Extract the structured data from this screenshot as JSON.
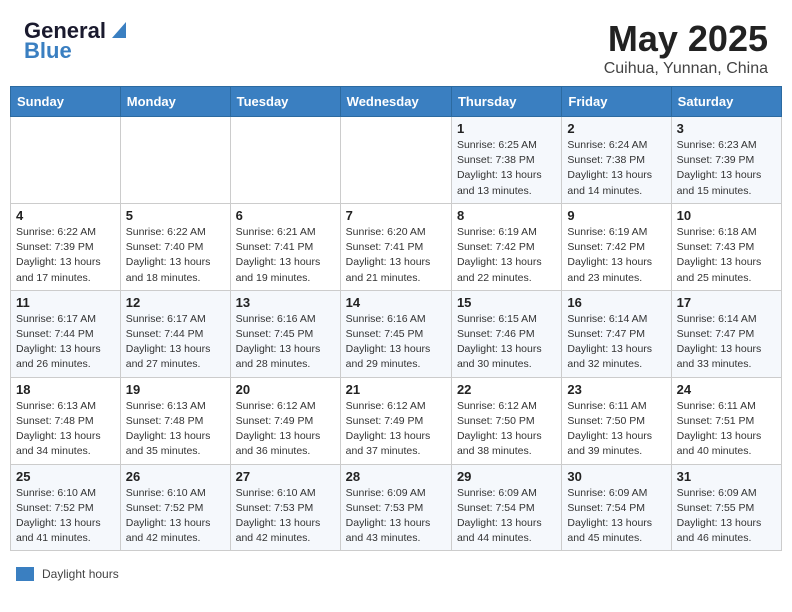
{
  "header": {
    "logo_line1": "General",
    "logo_line2": "Blue",
    "main_title": "May 2025",
    "subtitle": "Cuihua, Yunnan, China"
  },
  "weekdays": [
    "Sunday",
    "Monday",
    "Tuesday",
    "Wednesday",
    "Thursday",
    "Friday",
    "Saturday"
  ],
  "weeks": [
    [
      {
        "day": "",
        "info": ""
      },
      {
        "day": "",
        "info": ""
      },
      {
        "day": "",
        "info": ""
      },
      {
        "day": "",
        "info": ""
      },
      {
        "day": "1",
        "info": "Sunrise: 6:25 AM\nSunset: 7:38 PM\nDaylight: 13 hours\nand 13 minutes."
      },
      {
        "day": "2",
        "info": "Sunrise: 6:24 AM\nSunset: 7:38 PM\nDaylight: 13 hours\nand 14 minutes."
      },
      {
        "day": "3",
        "info": "Sunrise: 6:23 AM\nSunset: 7:39 PM\nDaylight: 13 hours\nand 15 minutes."
      }
    ],
    [
      {
        "day": "4",
        "info": "Sunrise: 6:22 AM\nSunset: 7:39 PM\nDaylight: 13 hours\nand 17 minutes."
      },
      {
        "day": "5",
        "info": "Sunrise: 6:22 AM\nSunset: 7:40 PM\nDaylight: 13 hours\nand 18 minutes."
      },
      {
        "day": "6",
        "info": "Sunrise: 6:21 AM\nSunset: 7:41 PM\nDaylight: 13 hours\nand 19 minutes."
      },
      {
        "day": "7",
        "info": "Sunrise: 6:20 AM\nSunset: 7:41 PM\nDaylight: 13 hours\nand 21 minutes."
      },
      {
        "day": "8",
        "info": "Sunrise: 6:19 AM\nSunset: 7:42 PM\nDaylight: 13 hours\nand 22 minutes."
      },
      {
        "day": "9",
        "info": "Sunrise: 6:19 AM\nSunset: 7:42 PM\nDaylight: 13 hours\nand 23 minutes."
      },
      {
        "day": "10",
        "info": "Sunrise: 6:18 AM\nSunset: 7:43 PM\nDaylight: 13 hours\nand 25 minutes."
      }
    ],
    [
      {
        "day": "11",
        "info": "Sunrise: 6:17 AM\nSunset: 7:44 PM\nDaylight: 13 hours\nand 26 minutes."
      },
      {
        "day": "12",
        "info": "Sunrise: 6:17 AM\nSunset: 7:44 PM\nDaylight: 13 hours\nand 27 minutes."
      },
      {
        "day": "13",
        "info": "Sunrise: 6:16 AM\nSunset: 7:45 PM\nDaylight: 13 hours\nand 28 minutes."
      },
      {
        "day": "14",
        "info": "Sunrise: 6:16 AM\nSunset: 7:45 PM\nDaylight: 13 hours\nand 29 minutes."
      },
      {
        "day": "15",
        "info": "Sunrise: 6:15 AM\nSunset: 7:46 PM\nDaylight: 13 hours\nand 30 minutes."
      },
      {
        "day": "16",
        "info": "Sunrise: 6:14 AM\nSunset: 7:47 PM\nDaylight: 13 hours\nand 32 minutes."
      },
      {
        "day": "17",
        "info": "Sunrise: 6:14 AM\nSunset: 7:47 PM\nDaylight: 13 hours\nand 33 minutes."
      }
    ],
    [
      {
        "day": "18",
        "info": "Sunrise: 6:13 AM\nSunset: 7:48 PM\nDaylight: 13 hours\nand 34 minutes."
      },
      {
        "day": "19",
        "info": "Sunrise: 6:13 AM\nSunset: 7:48 PM\nDaylight: 13 hours\nand 35 minutes."
      },
      {
        "day": "20",
        "info": "Sunrise: 6:12 AM\nSunset: 7:49 PM\nDaylight: 13 hours\nand 36 minutes."
      },
      {
        "day": "21",
        "info": "Sunrise: 6:12 AM\nSunset: 7:49 PM\nDaylight: 13 hours\nand 37 minutes."
      },
      {
        "day": "22",
        "info": "Sunrise: 6:12 AM\nSunset: 7:50 PM\nDaylight: 13 hours\nand 38 minutes."
      },
      {
        "day": "23",
        "info": "Sunrise: 6:11 AM\nSunset: 7:50 PM\nDaylight: 13 hours\nand 39 minutes."
      },
      {
        "day": "24",
        "info": "Sunrise: 6:11 AM\nSunset: 7:51 PM\nDaylight: 13 hours\nand 40 minutes."
      }
    ],
    [
      {
        "day": "25",
        "info": "Sunrise: 6:10 AM\nSunset: 7:52 PM\nDaylight: 13 hours\nand 41 minutes."
      },
      {
        "day": "26",
        "info": "Sunrise: 6:10 AM\nSunset: 7:52 PM\nDaylight: 13 hours\nand 42 minutes."
      },
      {
        "day": "27",
        "info": "Sunrise: 6:10 AM\nSunset: 7:53 PM\nDaylight: 13 hours\nand 42 minutes."
      },
      {
        "day": "28",
        "info": "Sunrise: 6:09 AM\nSunset: 7:53 PM\nDaylight: 13 hours\nand 43 minutes."
      },
      {
        "day": "29",
        "info": "Sunrise: 6:09 AM\nSunset: 7:54 PM\nDaylight: 13 hours\nand 44 minutes."
      },
      {
        "day": "30",
        "info": "Sunrise: 6:09 AM\nSunset: 7:54 PM\nDaylight: 13 hours\nand 45 minutes."
      },
      {
        "day": "31",
        "info": "Sunrise: 6:09 AM\nSunset: 7:55 PM\nDaylight: 13 hours\nand 46 minutes."
      }
    ]
  ],
  "legend": {
    "color": "#3a7fc1",
    "label": "Daylight hours"
  }
}
